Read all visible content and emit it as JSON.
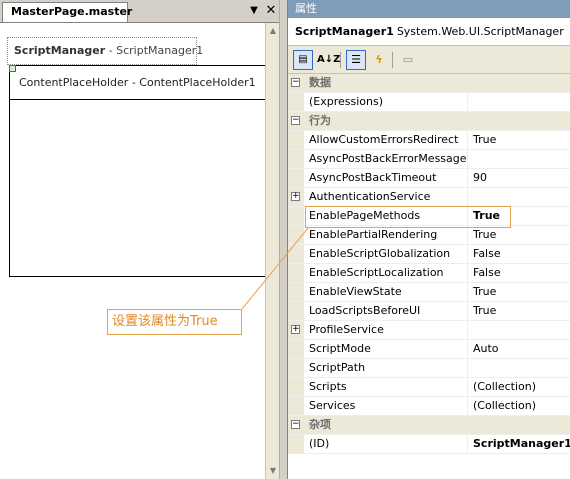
{
  "designer": {
    "tab_title": "MasterPage.master",
    "scriptmanager_control": {
      "name": "ScriptManager",
      "separator": " - ",
      "id": "ScriptManager1"
    },
    "contentplaceholder_label": "ContentPlaceHolder - ContentPlaceHolder1"
  },
  "callout": {
    "text": "设置该属性为True",
    "color": "#e08a24"
  },
  "properties": {
    "title": "属性",
    "object_name": "ScriptManager1",
    "object_type": "System.Web.UI.ScriptManager",
    "toolbar": {
      "categorized_icon": "categorized-icon",
      "alphabetical_label": "A↓Z",
      "properties_icon": "properties-icon",
      "events_icon": "lightning-icon",
      "property_pages_icon": "property-pages-icon"
    },
    "rows": [
      {
        "type": "category",
        "expander": "⊟",
        "name": "数据"
      },
      {
        "type": "prop",
        "name": "(Expressions)",
        "value": ""
      },
      {
        "type": "category",
        "expander": "⊟",
        "name": "行为"
      },
      {
        "type": "prop",
        "name": "AllowCustomErrorsRedirect",
        "value": "True"
      },
      {
        "type": "prop",
        "name": "AsyncPostBackErrorMessage",
        "value": ""
      },
      {
        "type": "prop",
        "name": "AsyncPostBackTimeout",
        "value": "90"
      },
      {
        "type": "prop",
        "expander": "+",
        "name": "AuthenticationService",
        "value": ""
      },
      {
        "type": "prop",
        "name": "EnablePageMethods",
        "value": "True",
        "bold": true
      },
      {
        "type": "prop",
        "name": "EnablePartialRendering",
        "value": "True"
      },
      {
        "type": "prop",
        "name": "EnableScriptGlobalization",
        "value": "False"
      },
      {
        "type": "prop",
        "name": "EnableScriptLocalization",
        "value": "False"
      },
      {
        "type": "prop",
        "name": "EnableViewState",
        "value": "True"
      },
      {
        "type": "prop",
        "name": "LoadScriptsBeforeUI",
        "value": "True"
      },
      {
        "type": "prop",
        "expander": "+",
        "name": "ProfileService",
        "value": ""
      },
      {
        "type": "prop",
        "name": "ScriptMode",
        "value": "Auto"
      },
      {
        "type": "prop",
        "name": "ScriptPath",
        "value": ""
      },
      {
        "type": "prop",
        "name": "Scripts",
        "value": "(Collection)"
      },
      {
        "type": "prop",
        "name": "Services",
        "value": "(Collection)"
      },
      {
        "type": "category",
        "expander": "⊟",
        "name": "杂项"
      },
      {
        "type": "prop",
        "name": "(ID)",
        "value": "ScriptManager1",
        "bold": true
      }
    ]
  }
}
